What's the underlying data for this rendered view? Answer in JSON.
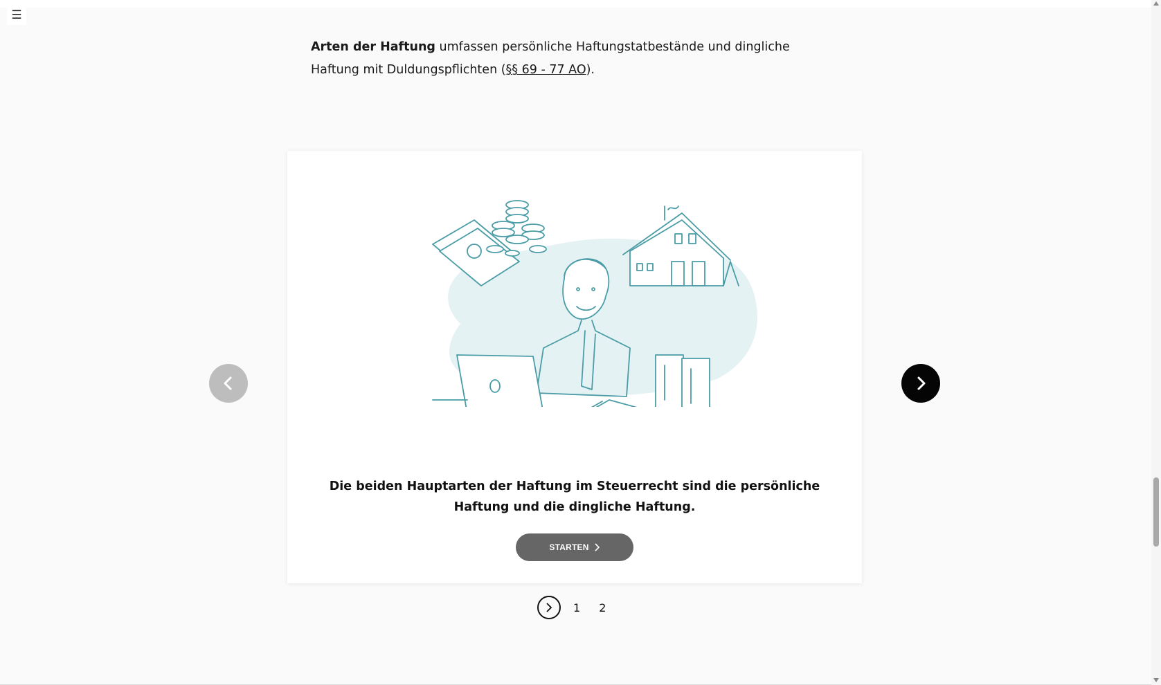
{
  "header": {
    "menu_icon": "hamburger-icon",
    "menu_label": "☰"
  },
  "intro": {
    "bold": "Arten der Haftung",
    "text1": " umfassen persönliche Haftungstatbestände und dingliche Haftung mit Duldungspflichten (",
    "link": "§§ 69 - 77 AO",
    "text2": ")."
  },
  "slide": {
    "caption": "Die beiden Hauptarten der Haftung im Steuerrecht sind die persönliche Haftung und die dingliche Haftung.",
    "button_label": "STARTEN"
  },
  "pagination": {
    "pages": [
      "1",
      "2"
    ]
  },
  "colors": {
    "illustration": "#4a9ca6",
    "blob": "#e4f2f3",
    "button": "#666666"
  }
}
